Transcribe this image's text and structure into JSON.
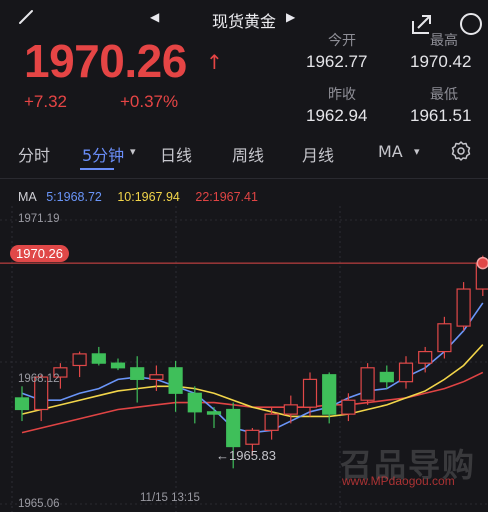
{
  "header": {
    "title": "现货黄金",
    "prev_symbol": "◀",
    "next_symbol": "▶",
    "icons": [
      "back-icon",
      "share-icon",
      "search-icon"
    ]
  },
  "quote": {
    "price": "1970.26",
    "direction_symbol": "↑",
    "change": "+7.32",
    "change_pct": "+0.37%",
    "stats": {
      "open_label": "今开",
      "open_value": "1962.77",
      "high_label": "最高",
      "high_value": "1970.42",
      "prev_close_label": "昨收",
      "prev_close_value": "1962.94",
      "low_label": "最低",
      "low_value": "1961.51"
    }
  },
  "tabs": [
    {
      "label": "分时"
    },
    {
      "label": "5分钟",
      "active": true
    },
    {
      "label": "日线"
    },
    {
      "label": "周线"
    },
    {
      "label": "月线"
    },
    {
      "label": "MA"
    }
  ],
  "dropdown_symbol": "▾",
  "ma_legend": {
    "label": "MA",
    "ma5": "5:1968.72",
    "ma10": "10:1967.94",
    "ma22": "22:1967.41"
  },
  "chart_axis": {
    "top_label": "1971.19",
    "mid_label": "1968.12",
    "bottom_label": "1965.06",
    "current_tag": "1970.26",
    "low_annotation": "←1965.83",
    "time_label": "11/15 13:15"
  },
  "watermark": {
    "text": "召品导购",
    "url": "www.MPdaogou.com"
  },
  "colors": {
    "up": "#e04848",
    "down": "#3fbf5a",
    "ma5": "#6a95f8",
    "ma10": "#f2d54a",
    "ma22": "#e04444",
    "accent": "#6a8df7"
  },
  "chart_data": {
    "type": "candlestick",
    "interval": "5分钟",
    "ylim": [
      1965.06,
      1971.19
    ],
    "candles": [
      {
        "o": 1967.35,
        "h": 1967.6,
        "l": 1966.85,
        "c": 1967.1
      },
      {
        "o": 1967.1,
        "h": 1967.85,
        "l": 1966.85,
        "c": 1967.8
      },
      {
        "o": 1967.8,
        "h": 1968.1,
        "l": 1967.55,
        "c": 1968.0
      },
      {
        "o": 1968.05,
        "h": 1968.35,
        "l": 1967.8,
        "c": 1968.3
      },
      {
        "o": 1968.3,
        "h": 1968.45,
        "l": 1968.05,
        "c": 1968.1
      },
      {
        "o": 1968.1,
        "h": 1968.2,
        "l": 1967.95,
        "c": 1968.0
      },
      {
        "o": 1968.0,
        "h": 1968.25,
        "l": 1967.25,
        "c": 1967.75
      },
      {
        "o": 1967.75,
        "h": 1968.05,
        "l": 1967.5,
        "c": 1967.85
      },
      {
        "o": 1968.0,
        "h": 1968.15,
        "l": 1967.05,
        "c": 1967.45
      },
      {
        "o": 1967.45,
        "h": 1967.6,
        "l": 1966.8,
        "c": 1967.05
      },
      {
        "o": 1967.05,
        "h": 1967.15,
        "l": 1966.7,
        "c": 1967.0
      },
      {
        "o": 1967.1,
        "h": 1967.25,
        "l": 1965.83,
        "c": 1966.3
      },
      {
        "o": 1966.35,
        "h": 1966.7,
        "l": 1966.1,
        "c": 1966.65
      },
      {
        "o": 1966.65,
        "h": 1967.15,
        "l": 1966.45,
        "c": 1967.0
      },
      {
        "o": 1967.0,
        "h": 1967.4,
        "l": 1966.8,
        "c": 1967.2
      },
      {
        "o": 1967.15,
        "h": 1967.9,
        "l": 1966.95,
        "c": 1967.75
      },
      {
        "o": 1967.85,
        "h": 1967.9,
        "l": 1966.8,
        "c": 1967.0
      },
      {
        "o": 1967.0,
        "h": 1967.45,
        "l": 1966.85,
        "c": 1967.3
      },
      {
        "o": 1967.3,
        "h": 1968.1,
        "l": 1967.2,
        "c": 1968.0
      },
      {
        "o": 1967.9,
        "h": 1968.05,
        "l": 1967.55,
        "c": 1967.7
      },
      {
        "o": 1967.7,
        "h": 1968.25,
        "l": 1967.55,
        "c": 1968.1
      },
      {
        "o": 1968.1,
        "h": 1968.45,
        "l": 1967.9,
        "c": 1968.35
      },
      {
        "o": 1968.35,
        "h": 1969.1,
        "l": 1968.2,
        "c": 1968.95
      },
      {
        "o": 1968.9,
        "h": 1969.85,
        "l": 1968.8,
        "c": 1969.7
      },
      {
        "o": 1969.7,
        "h": 1970.42,
        "l": 1969.55,
        "c": 1970.26
      }
    ],
    "ma5": [
      1967.45,
      1967.3,
      1967.3,
      1967.45,
      1967.55,
      1967.75,
      1967.8,
      1967.75,
      1967.6,
      1967.45,
      1967.1,
      1966.7,
      1966.6,
      1966.65,
      1966.85,
      1967.05,
      1967.15,
      1967.35,
      1967.5,
      1967.55,
      1967.8,
      1968.0,
      1968.35,
      1968.8,
      1969.4
    ],
    "ma10": [
      1967.0,
      1967.1,
      1967.2,
      1967.3,
      1967.4,
      1967.5,
      1967.55,
      1967.6,
      1967.6,
      1967.55,
      1967.45,
      1967.3,
      1967.15,
      1967.05,
      1966.95,
      1966.95,
      1966.95,
      1967.0,
      1967.1,
      1967.2,
      1967.35,
      1967.5,
      1967.75,
      1968.05,
      1968.5
    ],
    "ma22": [
      1966.6,
      1966.7,
      1966.8,
      1966.9,
      1967.0,
      1967.1,
      1967.15,
      1967.2,
      1967.25,
      1967.25,
      1967.25,
      1967.2,
      1967.15,
      1967.15,
      1967.15,
      1967.15,
      1967.2,
      1967.2,
      1967.25,
      1967.3,
      1967.35,
      1967.45,
      1967.55,
      1967.7,
      1967.9
    ]
  }
}
